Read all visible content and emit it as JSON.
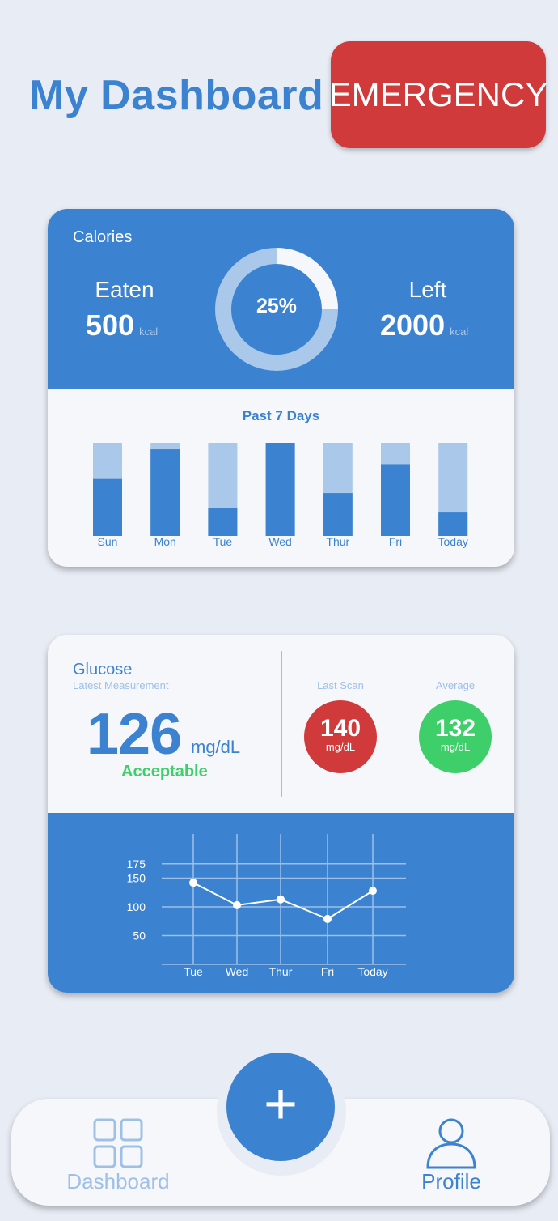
{
  "header": {
    "title": "My Dashboard",
    "emergency_label": "EMERGENCY"
  },
  "calories": {
    "label": "Calories",
    "eaten_label": "Eaten",
    "eaten_value": "500",
    "eaten_unit": "kcal",
    "left_label": "Left",
    "left_value": "2000",
    "left_unit": "kcal",
    "percent_label": "25%",
    "percent": 0.25,
    "history_title": "Past 7 Days"
  },
  "glucose": {
    "label": "Glucose",
    "sub_label": "Latest Measurement",
    "value": "126",
    "unit": "mg/dL",
    "status": "Acceptable",
    "last_scan_label": "Last Scan",
    "last_scan_value": "140",
    "last_scan_unit": "mg/dL",
    "average_label": "Average",
    "average_value": "132",
    "average_unit": "mg/dL"
  },
  "nav": {
    "fab_label": "+",
    "dashboard_label": "Dashboard",
    "profile_label": "Profile"
  },
  "colors": {
    "accent": "#3b82d0",
    "accent_light": "#9fc0e6",
    "danger": "#d13a3a",
    "success": "#3ecf6a"
  },
  "chart_data": [
    {
      "type": "bar",
      "title": "Past 7 Days",
      "categories": [
        "Sun",
        "Mon",
        "Tue",
        "Wed",
        "Thur",
        "Fri",
        "Today"
      ],
      "values": [
        0.62,
        0.93,
        0.3,
        1.0,
        0.46,
        0.77,
        0.26
      ]
    },
    {
      "type": "line",
      "categories": [
        "Tue",
        "Wed",
        "Thur",
        "Fri",
        "Today"
      ],
      "values": [
        142,
        103,
        113,
        79,
        128
      ],
      "yticks": [
        50,
        100,
        150,
        175
      ],
      "ylim": [
        0,
        200
      ],
      "grid": true
    }
  ]
}
